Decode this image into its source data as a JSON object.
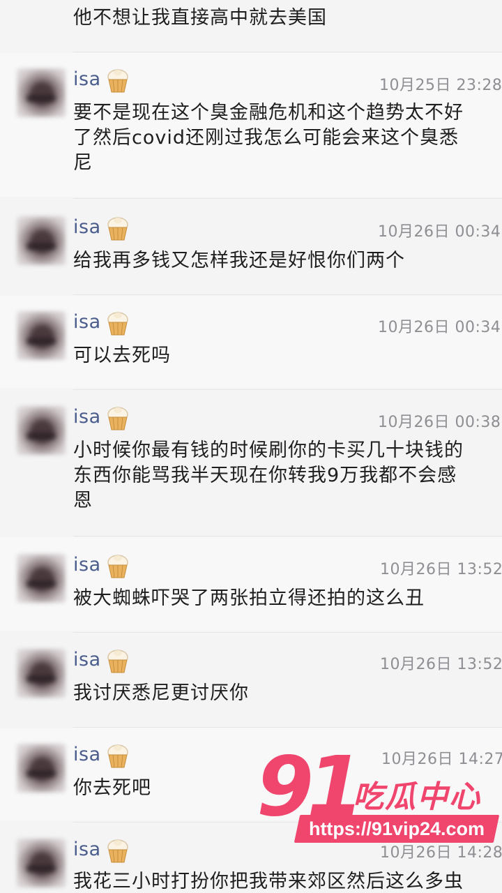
{
  "top_fragment": "他不想让我直接高中就去美国",
  "messages": [
    {
      "name": "isa",
      "time": "10月25日 23:28",
      "text": "要不是现在这个臭金融危机和这个趋势太不好\n了然后covid还刚过我怎么可能会来这个臭悉\n尼"
    },
    {
      "name": "isa",
      "time": "10月26日 00:34",
      "text": "给我再多钱又怎样我还是好恨你们两个"
    },
    {
      "name": "isa",
      "time": "10月26日 00:34",
      "text": "可以去死吗"
    },
    {
      "name": "isa",
      "time": "10月26日 00:38",
      "text": "小时候你最有钱的时候刷你的卡买几十块钱的\n东西你能骂我半天现在你转我9万我都不会感\n恩"
    },
    {
      "name": "isa",
      "time": "10月26日 13:52",
      "text": "被大蜘蛛吓哭了两张拍立得还拍的这么丑"
    },
    {
      "name": "isa",
      "time": "10月26日 13:52",
      "text": "我讨厌悉尼更讨厌你"
    },
    {
      "name": "isa",
      "time": "10月26日 14:27",
      "text": "你去死吧"
    },
    {
      "name": "isa",
      "time": "10月26日 14:28",
      "text": "我花三小时打扮你把我带来郊区然后这么多虫"
    }
  ],
  "watermark": {
    "number": "91",
    "title": "吃瓜中心",
    "url": "https://91vip24.com",
    "color": "#f0466e"
  },
  "icons": {
    "name_badge": "cupcake-icon",
    "avatar": "blurred-avatar"
  }
}
